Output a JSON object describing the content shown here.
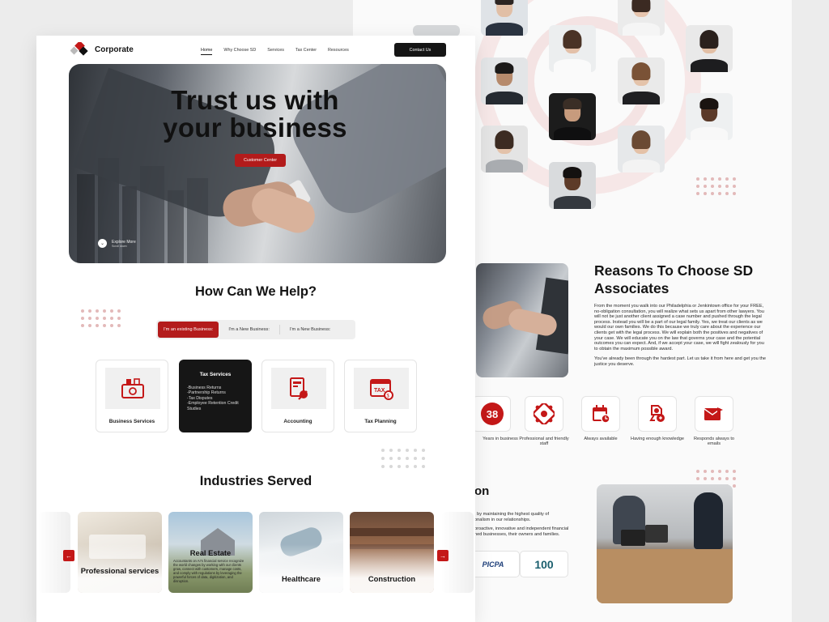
{
  "brand": {
    "name": "Corporate"
  },
  "nav": {
    "links": [
      "Home",
      "Why Choose SD",
      "Services",
      "Tax Center",
      "Resources"
    ],
    "contact": "Contact Us"
  },
  "hero": {
    "title": "Trust us with your business",
    "cta": "Customer Center",
    "explore": "Explore More",
    "explore_sub": "Scroll down"
  },
  "help": {
    "title": "How Can We Help?",
    "tabs": [
      "I'm an existing Business:",
      "I'm a New Business:",
      "I'm a New Business:"
    ]
  },
  "services": [
    {
      "label": "Business Services",
      "icon": "money-briefcase-icon"
    },
    {
      "label": "Tax Services",
      "items": [
        "-Business Returns",
        "-Partnership Returns",
        "-Tax Disputes",
        "-Employee Retention Credit Studies"
      ]
    },
    {
      "label": "Accounting",
      "icon": "accounting-document-icon"
    },
    {
      "label": "Tax Planning",
      "icon": "tax-calendar-icon"
    }
  ],
  "industries": {
    "title": "Industries Served",
    "cards": [
      {
        "label": "Professional services"
      },
      {
        "label": "Real Estate",
        "desc": "Accountants on Ar's financial service recognize the world changes by working with our clients grow, connect with customers, manage costs, and comply with regulations by leveraging the powerful forces of data, digitization, and disruption."
      },
      {
        "label": "Healthcare"
      },
      {
        "label": "Construction"
      }
    ]
  },
  "reasons": {
    "title": "Reasons To Choose SD Associates",
    "para1": "From the moment you walk into our Philadelphia or Jenkintown office for your FREE, no-obligation consultation, you will realize what sets us apart from other lawyers. You will not be just another client assigned a case number and pushed through the legal process. Instead you will be a part of our legal family. Yes, we treat our clients as we would our own families. We do this because we truly care about the experience our clients get with the legal process. We will explain both the positives and negatives of your case. We will educate you on the law that governs your case and the potential outcomes you can expect. And, if we accept your case, we will fight zealously for you to obtain the maximum possible award.",
    "para2": "You've already been through the hardest part. Let us take it from here and get you the justice you deserve."
  },
  "features": [
    {
      "value": "38",
      "label": "Years in business"
    },
    {
      "label": "Professional and friendly staff",
      "icon": "team-icon"
    },
    {
      "label": "Always available",
      "icon": "calendar-icon"
    },
    {
      "label": "Having enough knowledge",
      "icon": "knowledge-icon"
    },
    {
      "label": "Responds always to emails",
      "icon": "email-icon"
    }
  ],
  "about": {
    "heading": "on",
    "line1": ", by maintaining the highest quality of",
    "line2": "onalism in our relationships.",
    "line3": "proactive, innovative and independent financial",
    "line4": "ned businesses, their owners and families.",
    "logos": [
      "PICPA",
      "100"
    ]
  },
  "colors": {
    "accent": "#b31b1b",
    "dark": "#161616"
  }
}
